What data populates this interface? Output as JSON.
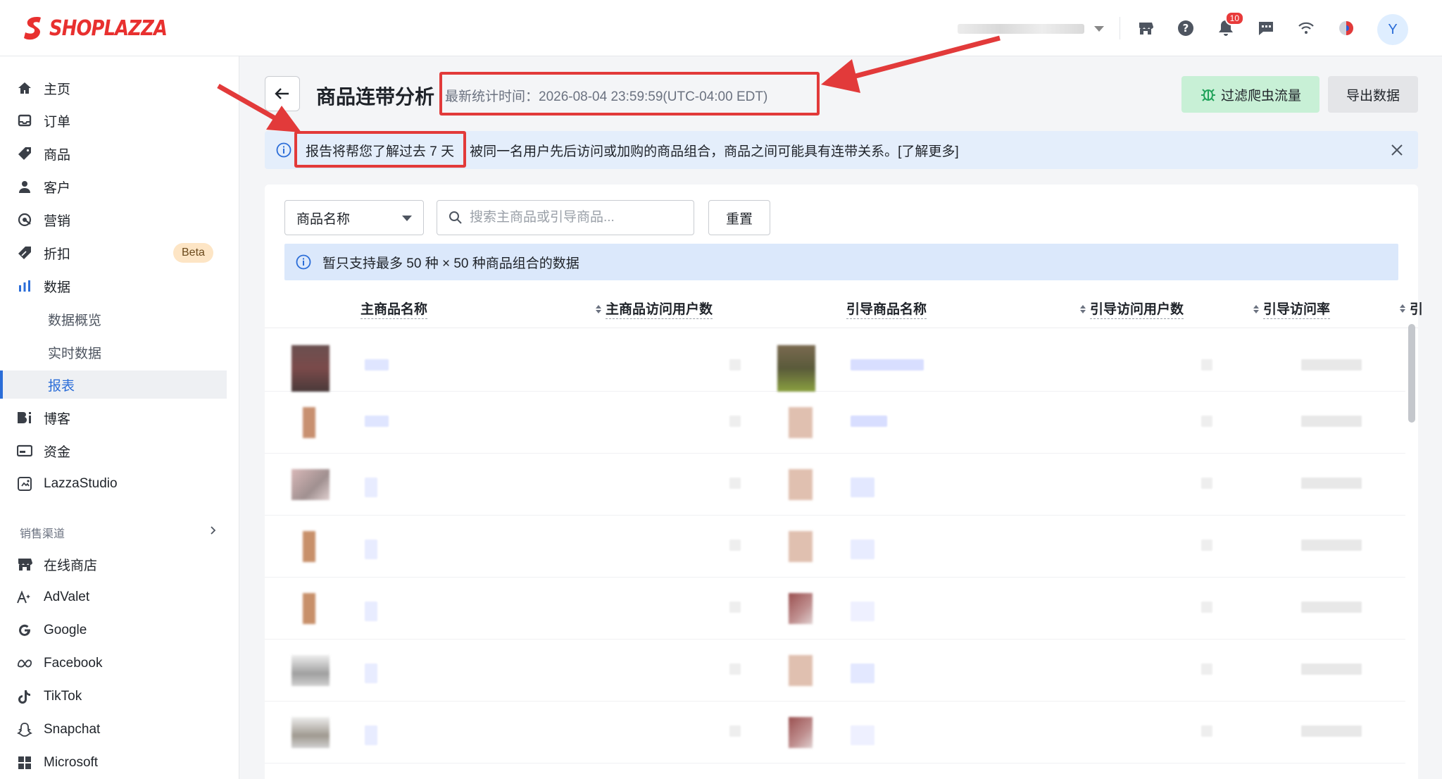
{
  "brand": {
    "name": "SHOPLAZZA",
    "color": "#e8302f"
  },
  "topbar": {
    "icons": [
      "store-icon",
      "help-icon",
      "bell-icon",
      "chat-icon",
      "wifi-icon",
      "app-icon"
    ],
    "notification_count": "10",
    "avatar_initial": "Y"
  },
  "sidebar": {
    "items": [
      {
        "label": "主页",
        "icon": "home-icon"
      },
      {
        "label": "订单",
        "icon": "inbox-icon"
      },
      {
        "label": "商品",
        "icon": "tag-icon"
      },
      {
        "label": "客户",
        "icon": "person-icon"
      },
      {
        "label": "营销",
        "icon": "marketing-icon"
      },
      {
        "label": "折扣",
        "icon": "discount-icon",
        "badge": "Beta"
      },
      {
        "label": "数据",
        "icon": "chart-icon"
      },
      {
        "label": "博客",
        "icon": "blog-icon"
      },
      {
        "label": "资金",
        "icon": "wallet-icon"
      },
      {
        "label": "LazzaStudio",
        "icon": "studio-icon"
      }
    ],
    "data_sub": [
      "数据概览",
      "实时数据",
      "报表"
    ],
    "active_sub": "报表",
    "channels_label": "销售渠道",
    "channels": [
      {
        "label": "在线商店",
        "icon": "store-icon"
      },
      {
        "label": "AdValet",
        "icon": "advalet-icon"
      },
      {
        "label": "Google",
        "icon": "google-icon"
      },
      {
        "label": "Facebook",
        "icon": "meta-icon"
      },
      {
        "label": "TikTok",
        "icon": "tiktok-icon"
      },
      {
        "label": "Snapchat",
        "icon": "snapchat-icon"
      },
      {
        "label": "Microsoft",
        "icon": "microsoft-icon"
      }
    ]
  },
  "page": {
    "title": "商品连带分析",
    "update_time": "最新统计时间：2026-08-04 23:59:59(UTC-04:00 EDT)",
    "filter_bot_button": "过滤爬虫流量",
    "export_button": "导出数据",
    "banner_highlight": "报告将帮您了解过去 7 天",
    "banner_text": "被同一名用户先后访问或加购的商品组合，商品之间可能具有连带关系。[了解更多]",
    "filter": {
      "select_value": "商品名称",
      "search_placeholder": "搜索主商品或引导商品...",
      "reset_button": "重置"
    },
    "limit_notice": "暂只支持最多 50 种 × 50 种商品组合的数据",
    "table_headers": [
      "主商品名称",
      "主商品访问用户数",
      "引导商品名称",
      "引导访问用户数",
      "引导访问率",
      "引"
    ]
  }
}
